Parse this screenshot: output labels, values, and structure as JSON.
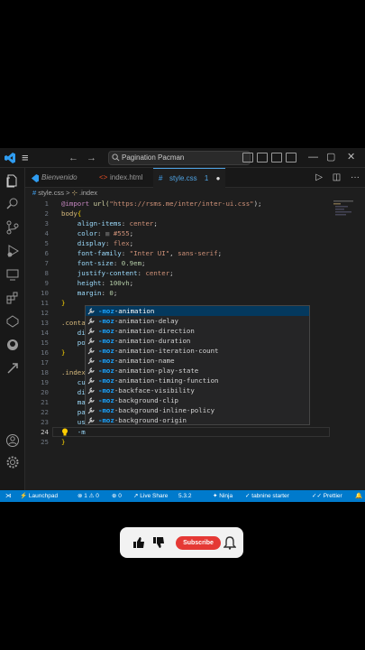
{
  "title_bar": {
    "menu_icon": "hamburger-icon",
    "back": "←",
    "forward": "→",
    "search_text": "Pagination Pacman",
    "controls": {
      "minimize": "—",
      "maximize": "▢",
      "close": "✕"
    }
  },
  "tabs": [
    {
      "label": "Bienvenido",
      "icon": "vscode-icon"
    },
    {
      "label": "index.html",
      "icon": "html-icon"
    },
    {
      "label": "style.css",
      "icon": "css-icon",
      "badge": "1",
      "dirty": "●"
    }
  ],
  "tab_actions": {
    "run": "▷",
    "split": "◫",
    "more": "···"
  },
  "breadcrumb": {
    "file": "style.css",
    "separator": ">",
    "symbol": ".index"
  },
  "editor": {
    "line_numbers": [
      "1",
      "2",
      "3",
      "4",
      "5",
      "6",
      "7",
      "8",
      "9",
      "10",
      "11",
      "12",
      "13",
      "14",
      "15",
      "16",
      "17",
      "18",
      "19",
      "20",
      "21",
      "22",
      "23",
      "24",
      "25"
    ],
    "current_line": "24",
    "lines": [
      [
        {
          "t": "@import ",
          "c": "k"
        },
        {
          "t": "url(",
          "c": "f"
        },
        {
          "t": "\"https://rsms.me/inter/inter-ui.css\"",
          "c": "s"
        },
        {
          "t": ");",
          "c": ""
        }
      ],
      [
        {
          "t": "body",
          "c": "sel"
        },
        {
          "t": "{",
          "c": "y"
        }
      ],
      [
        {
          "t": "    align-items",
          "c": "p"
        },
        {
          "t": ": ",
          "c": ""
        },
        {
          "t": "center",
          "c": "s"
        },
        {
          "t": ";",
          "c": ""
        }
      ],
      [
        {
          "t": "    color",
          "c": "p"
        },
        {
          "t": ": ",
          "c": ""
        },
        {
          "t": "■ ",
          "c": "sw"
        },
        {
          "t": "#555",
          "c": "s"
        },
        {
          "t": ";",
          "c": ""
        }
      ],
      [
        {
          "t": "    display",
          "c": "p"
        },
        {
          "t": ": ",
          "c": ""
        },
        {
          "t": "flex",
          "c": "s"
        },
        {
          "t": ";",
          "c": ""
        }
      ],
      [
        {
          "t": "    font-family",
          "c": "p"
        },
        {
          "t": ": ",
          "c": ""
        },
        {
          "t": "\"Inter UI\"",
          "c": "s"
        },
        {
          "t": ", ",
          "c": ""
        },
        {
          "t": "sans-serif",
          "c": "s"
        },
        {
          "t": ";",
          "c": ""
        }
      ],
      [
        {
          "t": "    font-size",
          "c": "p"
        },
        {
          "t": ": ",
          "c": ""
        },
        {
          "t": "0.9em",
          "c": "n"
        },
        {
          "t": ";",
          "c": ""
        }
      ],
      [
        {
          "t": "    justify-content",
          "c": "p"
        },
        {
          "t": ": ",
          "c": ""
        },
        {
          "t": "center",
          "c": "s"
        },
        {
          "t": ";",
          "c": ""
        }
      ],
      [
        {
          "t": "    height",
          "c": "p"
        },
        {
          "t": ": ",
          "c": ""
        },
        {
          "t": "100vh",
          "c": "n"
        },
        {
          "t": ";",
          "c": ""
        }
      ],
      [
        {
          "t": "    margin",
          "c": "p"
        },
        {
          "t": ": ",
          "c": ""
        },
        {
          "t": "0",
          "c": "n"
        },
        {
          "t": ";",
          "c": ""
        }
      ],
      [
        {
          "t": "}",
          "c": "y"
        }
      ],
      [],
      [
        {
          "t": ".conta",
          "c": "sel"
        }
      ],
      [
        {
          "t": "    di",
          "c": "p"
        }
      ],
      [
        {
          "t": "    po",
          "c": "p"
        }
      ],
      [
        {
          "t": "}",
          "c": "y"
        }
      ],
      [],
      [
        {
          "t": ".index",
          "c": "sel"
        }
      ],
      [
        {
          "t": "    cu",
          "c": "p"
        }
      ],
      [
        {
          "t": "    di",
          "c": "p"
        }
      ],
      [
        {
          "t": "    ma",
          "c": "p"
        }
      ],
      [
        {
          "t": "    pa",
          "c": "p"
        }
      ],
      [
        {
          "t": "    us",
          "c": "p"
        }
      ],
      [
        {
          "t": "    -m",
          "c": "p"
        }
      ],
      [
        {
          "t": "}",
          "c": "y"
        }
      ]
    ]
  },
  "autocomplete": {
    "icon": "wrench-icon",
    "items": [
      {
        "match": "-moz",
        "rest": "-animation"
      },
      {
        "match": "-moz",
        "rest": "-animation-delay"
      },
      {
        "match": "-moz",
        "rest": "-animation-direction"
      },
      {
        "match": "-moz",
        "rest": "-animation-duration"
      },
      {
        "match": "-moz",
        "rest": "-animation-iteration-count"
      },
      {
        "match": "-moz",
        "rest": "-animation-name"
      },
      {
        "match": "-moz",
        "rest": "-animation-play-state"
      },
      {
        "match": "-moz",
        "rest": "-animation-timing-function"
      },
      {
        "match": "-moz",
        "rest": "-backface-visibility"
      },
      {
        "match": "-moz",
        "rest": "-background-clip"
      },
      {
        "match": "-moz",
        "rest": "-background-inline-policy"
      },
      {
        "match": "-moz",
        "rest": "-background-origin"
      }
    ]
  },
  "status_bar": {
    "remote": "⋊",
    "launchpad": "Launchpad",
    "problems": "⊗ 1 ⚠ 0",
    "ports": "⊕ 0",
    "live_share": "Live Share",
    "version": "5.3.2",
    "ninja": "Ninja",
    "tabnine": "tabnine starter",
    "prettier": "Prettier",
    "bell": "🔔"
  },
  "youtube": {
    "subscribe": "Subscribe"
  },
  "colors": {
    "accent": "#007acc",
    "subscribe": "#e53935"
  }
}
